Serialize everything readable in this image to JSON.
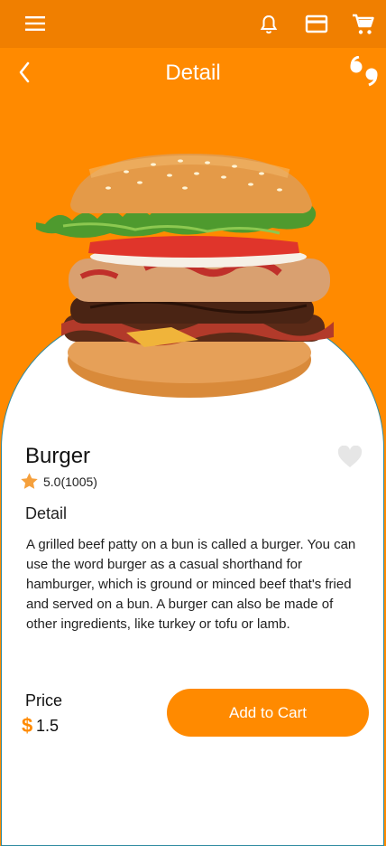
{
  "header": {
    "menu_icon": "hamburger-menu-icon",
    "bell_icon": "notification-bell-icon",
    "card_icon": "credit-card-icon",
    "cart_icon": "shopping-cart-icon"
  },
  "nav": {
    "title": "Detail",
    "back_icon": "chevron-left-icon",
    "quote_icon": "quote-icon"
  },
  "product": {
    "name": "Burger",
    "rating": "5.0(1005)",
    "detail_heading": "Detail",
    "description": "A grilled beef patty on a bun is called a burger. You can use the word burger as a casual shorthand for hamburger, which is ground or minced beef that's fried and served on a bun. A burger can also be made of other ingredients, like turkey or tofu or lamb.",
    "price_label": "Price",
    "currency": "$",
    "price": "1.5",
    "add_to_cart": "Add to Cart"
  },
  "colors": {
    "accent": "#FF8A00",
    "header": "#F07F00",
    "favorite_inactive": "#E6E6E6",
    "star": "#F5A03C"
  }
}
